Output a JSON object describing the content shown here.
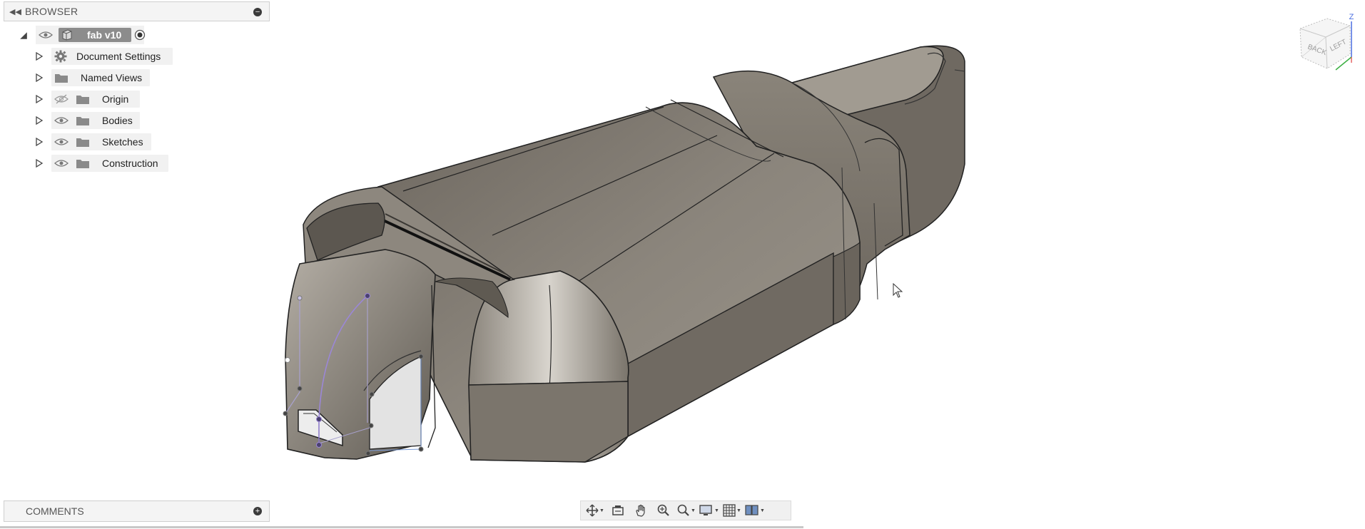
{
  "browser": {
    "title": "BROWSER",
    "root": {
      "label": "fab v10"
    },
    "items": [
      {
        "label": "Document Settings",
        "icon": "gear-icon"
      },
      {
        "label": "Named Views",
        "icon": "folder-icon"
      },
      {
        "label": "Origin",
        "icon": "folder-icon",
        "visibility": "hidden"
      },
      {
        "label": "Bodies",
        "icon": "folder-icon",
        "visibility": "visible"
      },
      {
        "label": "Sketches",
        "icon": "folder-icon",
        "visibility": "visible"
      },
      {
        "label": "Construction",
        "icon": "folder-icon",
        "visibility": "visible"
      }
    ]
  },
  "comments": {
    "title": "COMMENTS"
  },
  "toolbar": {
    "tools": [
      "orbit-icon",
      "look-at-icon",
      "pan-icon",
      "zoom-icon",
      "zoom-window-icon",
      "display-settings-icon",
      "grid-icon",
      "viewports-icon"
    ]
  },
  "viewcube": {
    "faces": [
      "BACK",
      "LEFT"
    ],
    "axis": "Z"
  },
  "colors": {
    "body": "#7d776f",
    "sketch": "#9b87d6",
    "panel": "#f4f4f4"
  }
}
